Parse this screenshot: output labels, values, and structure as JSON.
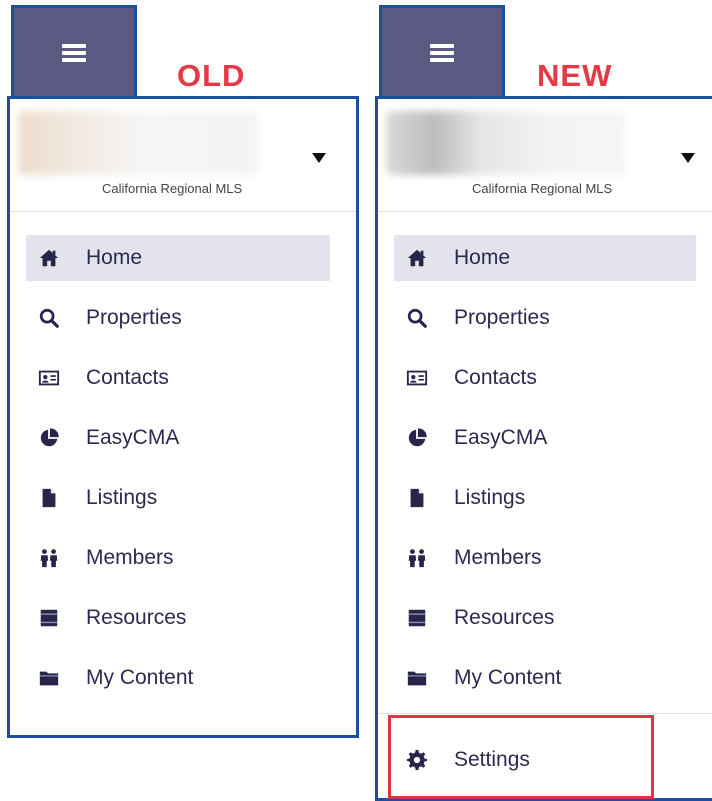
{
  "panels": [
    {
      "id": "old",
      "version_label": "OLD",
      "org_name": "California Regional MLS",
      "nav": [
        {
          "label": "Home",
          "icon": "home-icon",
          "active": true
        },
        {
          "label": "Properties",
          "icon": "search-icon",
          "active": false
        },
        {
          "label": "Contacts",
          "icon": "contact-card-icon",
          "active": false
        },
        {
          "label": "EasyCMA",
          "icon": "pie-chart-icon",
          "active": false
        },
        {
          "label": "Listings",
          "icon": "document-icon",
          "active": false
        },
        {
          "label": "Members",
          "icon": "people-icon",
          "active": false
        },
        {
          "label": "Resources",
          "icon": "book-icon",
          "active": false
        },
        {
          "label": "My Content",
          "icon": "folder-icon",
          "active": false
        }
      ]
    },
    {
      "id": "new",
      "version_label": "NEW",
      "org_name": "California Regional MLS",
      "nav": [
        {
          "label": "Home",
          "icon": "home-icon",
          "active": true
        },
        {
          "label": "Properties",
          "icon": "search-icon",
          "active": false
        },
        {
          "label": "Contacts",
          "icon": "contact-card-icon",
          "active": false
        },
        {
          "label": "EasyCMA",
          "icon": "pie-chart-icon",
          "active": false
        },
        {
          "label": "Listings",
          "icon": "document-icon",
          "active": false
        },
        {
          "label": "Members",
          "icon": "people-icon",
          "active": false
        },
        {
          "label": "Resources",
          "icon": "book-icon",
          "active": false
        },
        {
          "label": "My Content",
          "icon": "folder-icon",
          "active": false
        }
      ],
      "settings": {
        "label": "Settings",
        "icon": "gear-icon"
      }
    }
  ],
  "colors": {
    "tab_fill": "#5a5a82",
    "border_blue": "#1c4fa0",
    "label_red": "#e63946",
    "active_bg": "#e3e3ee",
    "icon_navy": "#26264a",
    "highlight_red": "#e0353f"
  }
}
